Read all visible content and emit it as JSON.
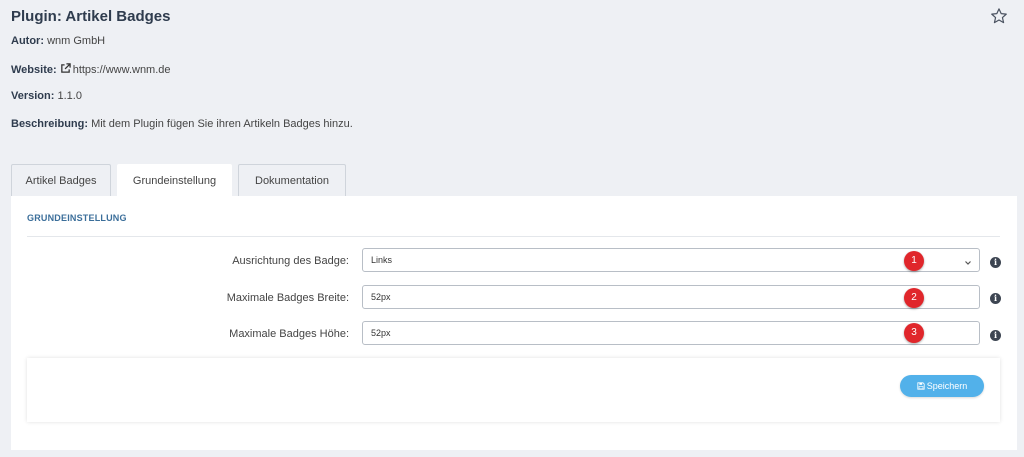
{
  "plugin": {
    "title": "Plugin: Artikel Badges",
    "author_label": "Autor:",
    "author": "wnm GmbH",
    "website_label": "Website:",
    "website": "https://www.wnm.de",
    "version_label": "Version:",
    "version": "1.1.0",
    "description_label": "Beschreibung:",
    "description": "Mit dem Plugin fügen Sie ihren Artikeln Badges hinzu."
  },
  "tabs": [
    {
      "label": "Artikel Badges",
      "active": false
    },
    {
      "label": "Grundeinstellung",
      "active": true
    },
    {
      "label": "Dokumentation",
      "active": false
    }
  ],
  "section": {
    "title": "GRUNDEINSTELLUNG"
  },
  "form": {
    "alignment": {
      "label": "Ausrichtung des Badge:",
      "value": "Links",
      "badge": "1"
    },
    "max_width": {
      "label": "Maximale Badges Breite:",
      "value": "52px",
      "badge": "2"
    },
    "max_height": {
      "label": "Maximale Badges Höhe:",
      "value": "52px",
      "badge": "3"
    }
  },
  "save_button": {
    "label": "Speichern"
  },
  "colors": {
    "accent": "#52b1ea",
    "badge": "#e0262b",
    "title": "#2f3c4e",
    "section": "#3b6e9a"
  }
}
